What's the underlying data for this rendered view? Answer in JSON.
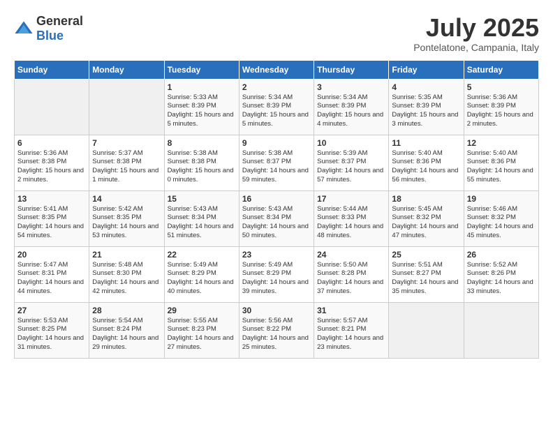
{
  "header": {
    "logo_general": "General",
    "logo_blue": "Blue",
    "month": "July 2025",
    "location": "Pontelatone, Campania, Italy"
  },
  "days_of_week": [
    "Sunday",
    "Monday",
    "Tuesday",
    "Wednesday",
    "Thursday",
    "Friday",
    "Saturday"
  ],
  "weeks": [
    [
      {
        "day": "",
        "empty": true
      },
      {
        "day": "",
        "empty": true
      },
      {
        "day": "1",
        "sunrise": "Sunrise: 5:33 AM",
        "sunset": "Sunset: 8:39 PM",
        "daylight": "Daylight: 15 hours and 5 minutes."
      },
      {
        "day": "2",
        "sunrise": "Sunrise: 5:34 AM",
        "sunset": "Sunset: 8:39 PM",
        "daylight": "Daylight: 15 hours and 5 minutes."
      },
      {
        "day": "3",
        "sunrise": "Sunrise: 5:34 AM",
        "sunset": "Sunset: 8:39 PM",
        "daylight": "Daylight: 15 hours and 4 minutes."
      },
      {
        "day": "4",
        "sunrise": "Sunrise: 5:35 AM",
        "sunset": "Sunset: 8:39 PM",
        "daylight": "Daylight: 15 hours and 3 minutes."
      },
      {
        "day": "5",
        "sunrise": "Sunrise: 5:36 AM",
        "sunset": "Sunset: 8:39 PM",
        "daylight": "Daylight: 15 hours and 2 minutes."
      }
    ],
    [
      {
        "day": "6",
        "sunrise": "Sunrise: 5:36 AM",
        "sunset": "Sunset: 8:38 PM",
        "daylight": "Daylight: 15 hours and 2 minutes."
      },
      {
        "day": "7",
        "sunrise": "Sunrise: 5:37 AM",
        "sunset": "Sunset: 8:38 PM",
        "daylight": "Daylight: 15 hours and 1 minute."
      },
      {
        "day": "8",
        "sunrise": "Sunrise: 5:38 AM",
        "sunset": "Sunset: 8:38 PM",
        "daylight": "Daylight: 15 hours and 0 minutes."
      },
      {
        "day": "9",
        "sunrise": "Sunrise: 5:38 AM",
        "sunset": "Sunset: 8:37 PM",
        "daylight": "Daylight: 14 hours and 59 minutes."
      },
      {
        "day": "10",
        "sunrise": "Sunrise: 5:39 AM",
        "sunset": "Sunset: 8:37 PM",
        "daylight": "Daylight: 14 hours and 57 minutes."
      },
      {
        "day": "11",
        "sunrise": "Sunrise: 5:40 AM",
        "sunset": "Sunset: 8:36 PM",
        "daylight": "Daylight: 14 hours and 56 minutes."
      },
      {
        "day": "12",
        "sunrise": "Sunrise: 5:40 AM",
        "sunset": "Sunset: 8:36 PM",
        "daylight": "Daylight: 14 hours and 55 minutes."
      }
    ],
    [
      {
        "day": "13",
        "sunrise": "Sunrise: 5:41 AM",
        "sunset": "Sunset: 8:35 PM",
        "daylight": "Daylight: 14 hours and 54 minutes."
      },
      {
        "day": "14",
        "sunrise": "Sunrise: 5:42 AM",
        "sunset": "Sunset: 8:35 PM",
        "daylight": "Daylight: 14 hours and 53 minutes."
      },
      {
        "day": "15",
        "sunrise": "Sunrise: 5:43 AM",
        "sunset": "Sunset: 8:34 PM",
        "daylight": "Daylight: 14 hours and 51 minutes."
      },
      {
        "day": "16",
        "sunrise": "Sunrise: 5:43 AM",
        "sunset": "Sunset: 8:34 PM",
        "daylight": "Daylight: 14 hours and 50 minutes."
      },
      {
        "day": "17",
        "sunrise": "Sunrise: 5:44 AM",
        "sunset": "Sunset: 8:33 PM",
        "daylight": "Daylight: 14 hours and 48 minutes."
      },
      {
        "day": "18",
        "sunrise": "Sunrise: 5:45 AM",
        "sunset": "Sunset: 8:32 PM",
        "daylight": "Daylight: 14 hours and 47 minutes."
      },
      {
        "day": "19",
        "sunrise": "Sunrise: 5:46 AM",
        "sunset": "Sunset: 8:32 PM",
        "daylight": "Daylight: 14 hours and 45 minutes."
      }
    ],
    [
      {
        "day": "20",
        "sunrise": "Sunrise: 5:47 AM",
        "sunset": "Sunset: 8:31 PM",
        "daylight": "Daylight: 14 hours and 44 minutes."
      },
      {
        "day": "21",
        "sunrise": "Sunrise: 5:48 AM",
        "sunset": "Sunset: 8:30 PM",
        "daylight": "Daylight: 14 hours and 42 minutes."
      },
      {
        "day": "22",
        "sunrise": "Sunrise: 5:49 AM",
        "sunset": "Sunset: 8:29 PM",
        "daylight": "Daylight: 14 hours and 40 minutes."
      },
      {
        "day": "23",
        "sunrise": "Sunrise: 5:49 AM",
        "sunset": "Sunset: 8:29 PM",
        "daylight": "Daylight: 14 hours and 39 minutes."
      },
      {
        "day": "24",
        "sunrise": "Sunrise: 5:50 AM",
        "sunset": "Sunset: 8:28 PM",
        "daylight": "Daylight: 14 hours and 37 minutes."
      },
      {
        "day": "25",
        "sunrise": "Sunrise: 5:51 AM",
        "sunset": "Sunset: 8:27 PM",
        "daylight": "Daylight: 14 hours and 35 minutes."
      },
      {
        "day": "26",
        "sunrise": "Sunrise: 5:52 AM",
        "sunset": "Sunset: 8:26 PM",
        "daylight": "Daylight: 14 hours and 33 minutes."
      }
    ],
    [
      {
        "day": "27",
        "sunrise": "Sunrise: 5:53 AM",
        "sunset": "Sunset: 8:25 PM",
        "daylight": "Daylight: 14 hours and 31 minutes."
      },
      {
        "day": "28",
        "sunrise": "Sunrise: 5:54 AM",
        "sunset": "Sunset: 8:24 PM",
        "daylight": "Daylight: 14 hours and 29 minutes."
      },
      {
        "day": "29",
        "sunrise": "Sunrise: 5:55 AM",
        "sunset": "Sunset: 8:23 PM",
        "daylight": "Daylight: 14 hours and 27 minutes."
      },
      {
        "day": "30",
        "sunrise": "Sunrise: 5:56 AM",
        "sunset": "Sunset: 8:22 PM",
        "daylight": "Daylight: 14 hours and 25 minutes."
      },
      {
        "day": "31",
        "sunrise": "Sunrise: 5:57 AM",
        "sunset": "Sunset: 8:21 PM",
        "daylight": "Daylight: 14 hours and 23 minutes."
      },
      {
        "day": "",
        "empty": true
      },
      {
        "day": "",
        "empty": true
      }
    ]
  ]
}
